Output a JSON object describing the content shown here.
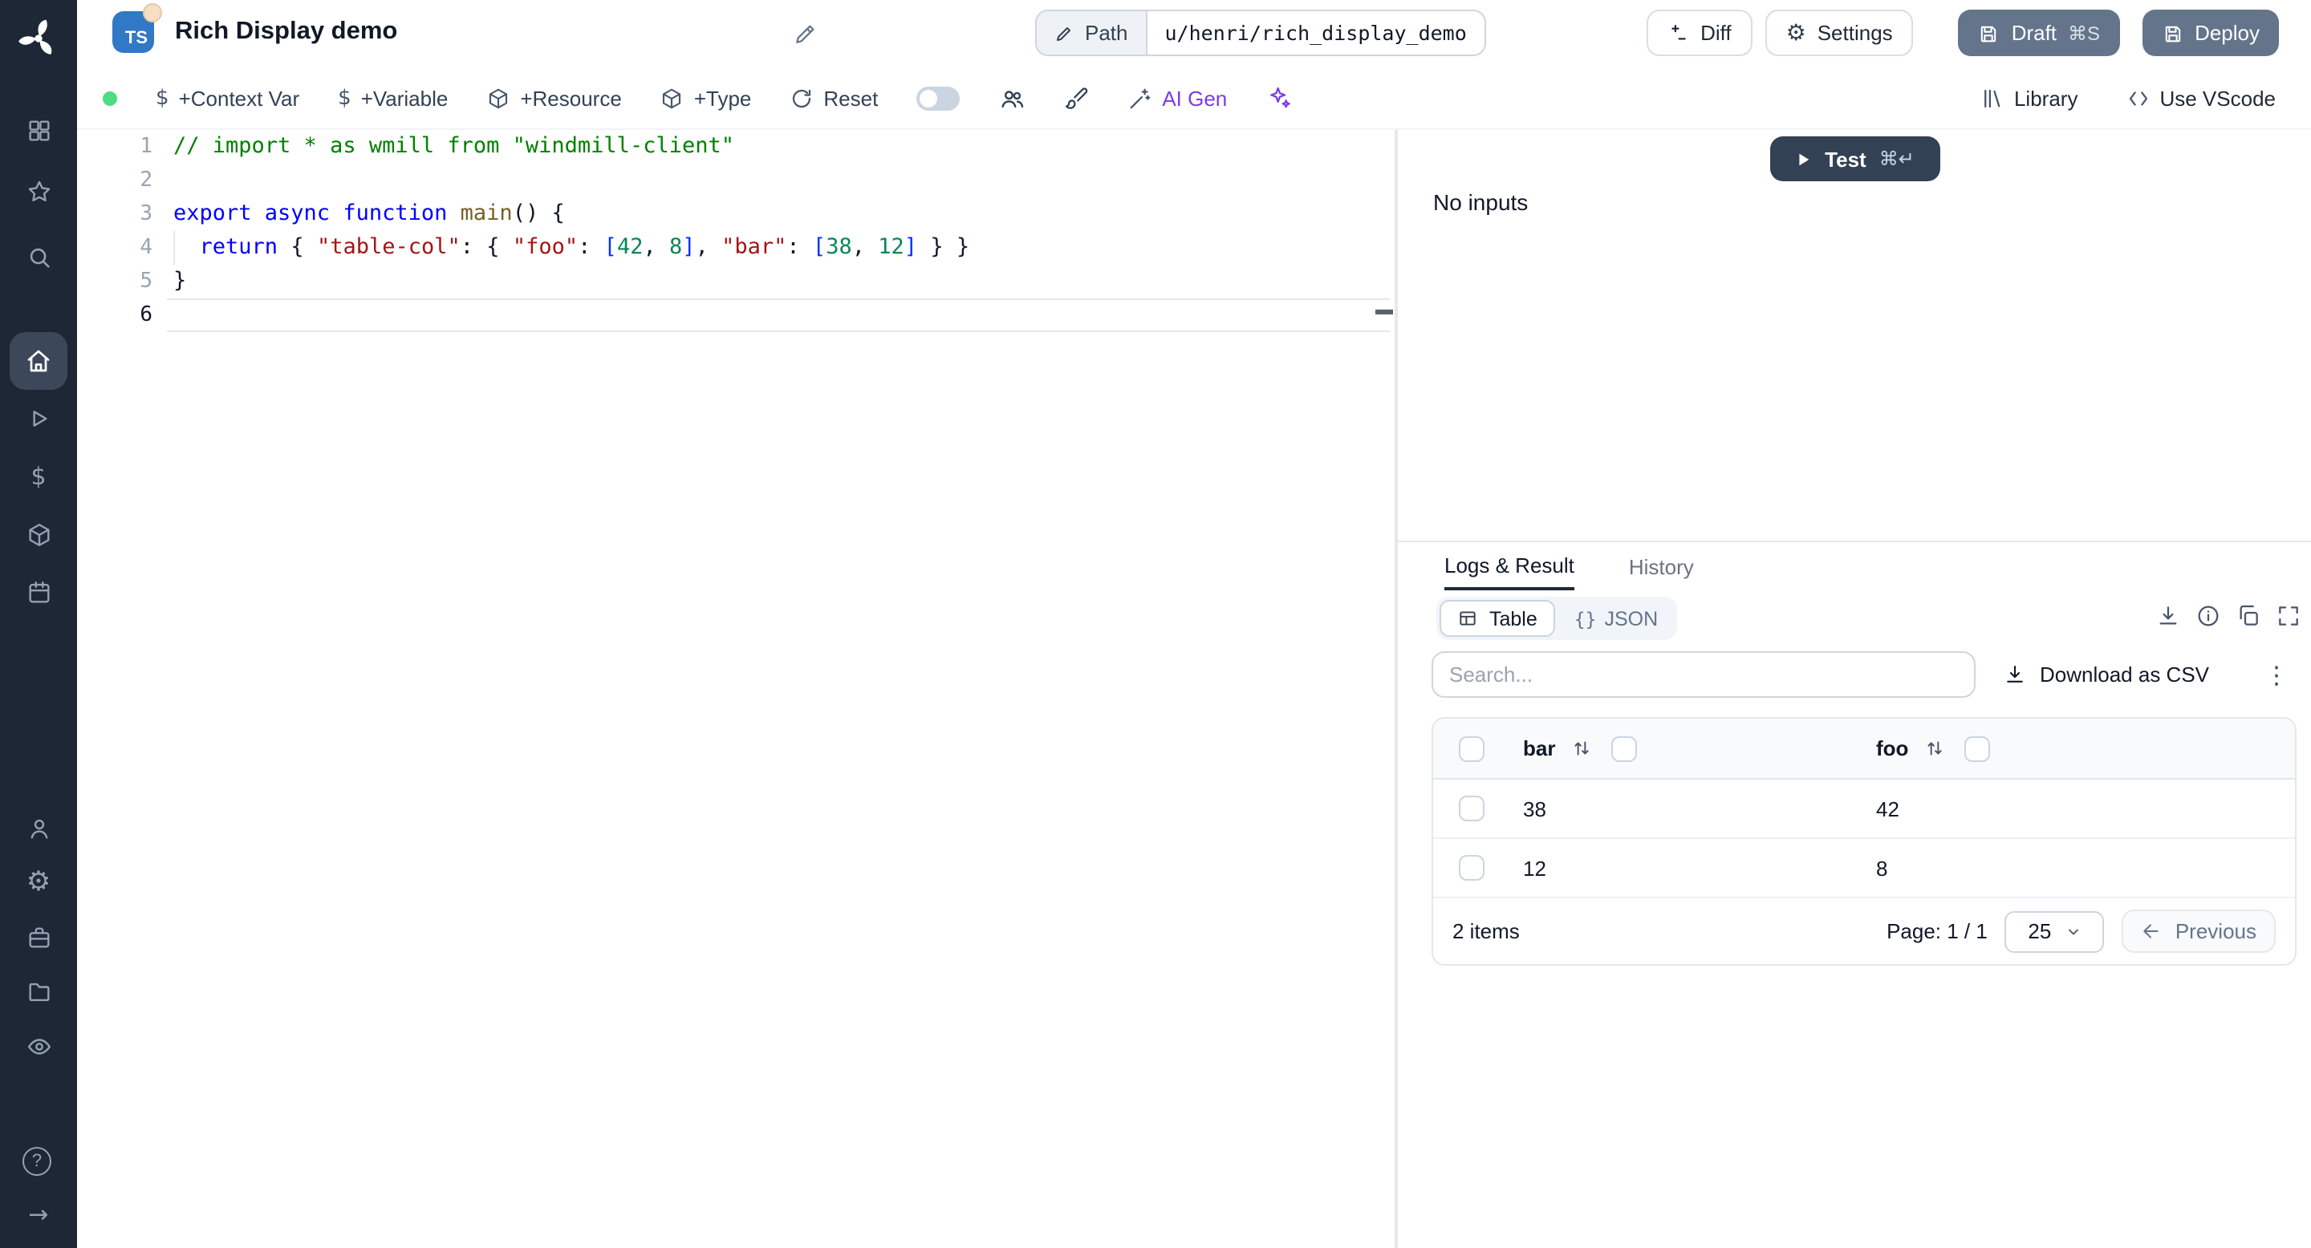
{
  "header": {
    "language_badge": "TS",
    "title": "Rich Display demo",
    "path_label": "Path",
    "path_value": "u/henri/rich_display_demo",
    "diff_label": "Diff",
    "settings_label": "Settings",
    "draft_label": "Draft",
    "draft_shortcut": "⌘S",
    "deploy_label": "Deploy"
  },
  "toolbar": {
    "context_var": "+Context Var",
    "variable": "+Variable",
    "resource": "+Resource",
    "type": "+Type",
    "reset": "Reset",
    "ai_gen": "AI Gen",
    "library": "Library",
    "use_vscode": "Use VScode"
  },
  "glyphs": {
    "dollar": "$",
    "gear": "⚙",
    "help": "?",
    "collapse_arrow": "→",
    "kebab": "⋮",
    "json_braces": "{}"
  },
  "sidebar": {
    "icons": [
      "windmill-logo",
      "apps-grid",
      "star",
      "search",
      "home",
      "play-runs",
      "dollar-variables",
      "cube-resources",
      "calendar-schedules",
      "user",
      "gear",
      "briefcase",
      "folder",
      "eye",
      "help",
      "collapse-arrow"
    ]
  },
  "editor": {
    "active_line": 6,
    "lines": [
      [
        [
          "cmt",
          "// import * as wmill from \"windmill-client\""
        ]
      ],
      [],
      [
        [
          "kw",
          "export async function"
        ],
        [
          "pl",
          " "
        ],
        [
          "fn",
          "main"
        ],
        [
          "pn",
          "()"
        ],
        [
          "pl",
          " "
        ],
        [
          "pn",
          "{"
        ]
      ],
      [
        [
          "pl",
          "  "
        ],
        [
          "kw",
          "return"
        ],
        [
          "pl",
          " "
        ],
        [
          "pn",
          "{"
        ],
        [
          "pl",
          " "
        ],
        [
          "str",
          "\"table-col\""
        ],
        [
          "pl",
          ": "
        ],
        [
          "pn",
          "{"
        ],
        [
          "pl",
          " "
        ],
        [
          "str",
          "\"foo\""
        ],
        [
          "pl",
          ": "
        ],
        [
          "br",
          "["
        ],
        [
          "num",
          "42"
        ],
        [
          "pl",
          ", "
        ],
        [
          "num",
          "8"
        ],
        [
          "br",
          "]"
        ],
        [
          "pl",
          ", "
        ],
        [
          "str",
          "\"bar\""
        ],
        [
          "pl",
          ": "
        ],
        [
          "br",
          "["
        ],
        [
          "num",
          "38"
        ],
        [
          "pl",
          ", "
        ],
        [
          "num",
          "12"
        ],
        [
          "br",
          "]"
        ],
        [
          "pl",
          " "
        ],
        [
          "pn",
          "}"
        ],
        [
          "pl",
          " "
        ],
        [
          "pn",
          "}"
        ]
      ],
      [
        [
          "pn",
          "}"
        ]
      ],
      []
    ]
  },
  "run_panel": {
    "test_label": "Test",
    "test_shortcut": "⌘↵",
    "no_inputs": "No inputs"
  },
  "result_panel": {
    "tab_logs": "Logs & Result",
    "tab_history": "History",
    "view_table": "Table",
    "view_json": "JSON",
    "search_placeholder": "Search...",
    "download_csv": "Download as CSV",
    "table": {
      "columns": [
        "bar",
        "foo"
      ],
      "rows": [
        [
          "38",
          "42"
        ],
        [
          "12",
          "8"
        ]
      ],
      "items_label": "2 items",
      "page_label": "Page: 1 / 1",
      "page_size": "25",
      "previous_label": "Previous"
    }
  }
}
